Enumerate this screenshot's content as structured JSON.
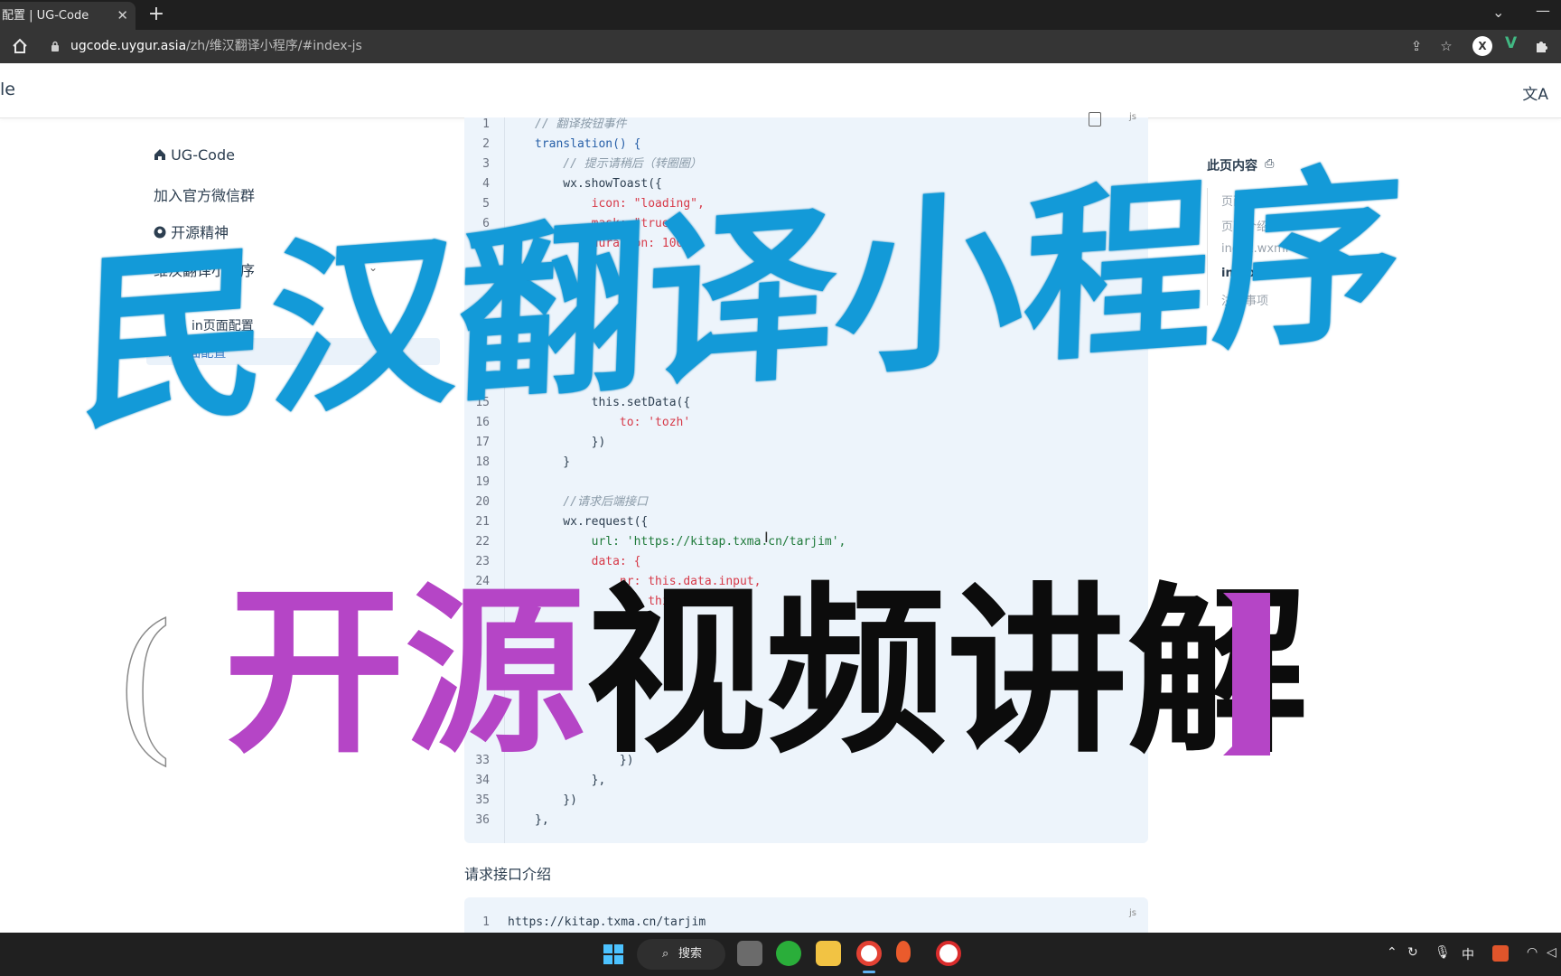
{
  "browser": {
    "tab_title": "配置 | UG-Code",
    "tab_close": "✕",
    "new_tab": "+",
    "url_host": "ugcode.uygur.asia",
    "url_path": "/zh/维汉翻译小程序/#index-js"
  },
  "site": {
    "title": "le"
  },
  "sidebar": {
    "items": [
      {
        "label": "UG-Code"
      },
      {
        "label": "加入官方微信群"
      },
      {
        "label": "开源精神"
      },
      {
        "label": "维汉翻译小程序"
      },
      {
        "label": "in页面配置"
      },
      {
        "label": "i 页面配置"
      }
    ]
  },
  "code": {
    "lines": [
      {
        "n": "1",
        "text": "// 翻译按钮事件"
      },
      {
        "n": "2",
        "text": "translation() {"
      },
      {
        "n": "3",
        "text": "    // 提示请稍后（转圈圈）"
      },
      {
        "n": "4",
        "text": "    wx.showToast({"
      },
      {
        "n": "5",
        "text": "        icon: \"loading\","
      },
      {
        "n": "6",
        "text": "        mask: \"true\","
      },
      {
        "n": "7",
        "text": "        duration: 10000"
      },
      {
        "n": "15",
        "text": "        this.setData({"
      },
      {
        "n": "16",
        "text": "            to: 'tozh'"
      },
      {
        "n": "17",
        "text": "        })"
      },
      {
        "n": "18",
        "text": "    }"
      },
      {
        "n": "19",
        "text": ""
      },
      {
        "n": "20",
        "text": "    //请求后端接口"
      },
      {
        "n": "21",
        "text": "    wx.request({"
      },
      {
        "n": "22",
        "text": "        url: 'https://kitap.txma.cn/tarjim',"
      },
      {
        "n": "23",
        "text": "        data: {"
      },
      {
        "n": "24",
        "text": "            nr: this.data.input,"
      },
      {
        "n": "25",
        "text": "            to: this.data.to"
      },
      {
        "n": "33",
        "text": "            })"
      },
      {
        "n": "34",
        "text": "        },"
      },
      {
        "n": "35",
        "text": "    })"
      },
      {
        "n": "36",
        "text": "},"
      }
    ],
    "lang": "js"
  },
  "content": {
    "section_text": "请求接口介绍",
    "code2_line_n": "1",
    "code2_line": "https://kitap.txma.cn/tarjim",
    "code2_lang": "js"
  },
  "toc": {
    "title": "此页内容",
    "items": [
      "页面目录",
      "页面介绍",
      "index.wxml",
      "index.js",
      "注意事项"
    ]
  },
  "overlay": {
    "title": "民汉翻译小程序",
    "sub_purple": "开源",
    "sub_black": "视频讲解"
  },
  "taskbar": {
    "search_label": "搜索",
    "ime": "中"
  },
  "colors": {
    "overlay_blue": "#139ad8",
    "overlay_purple": "#b545c6",
    "active_link": "#3578c4"
  }
}
